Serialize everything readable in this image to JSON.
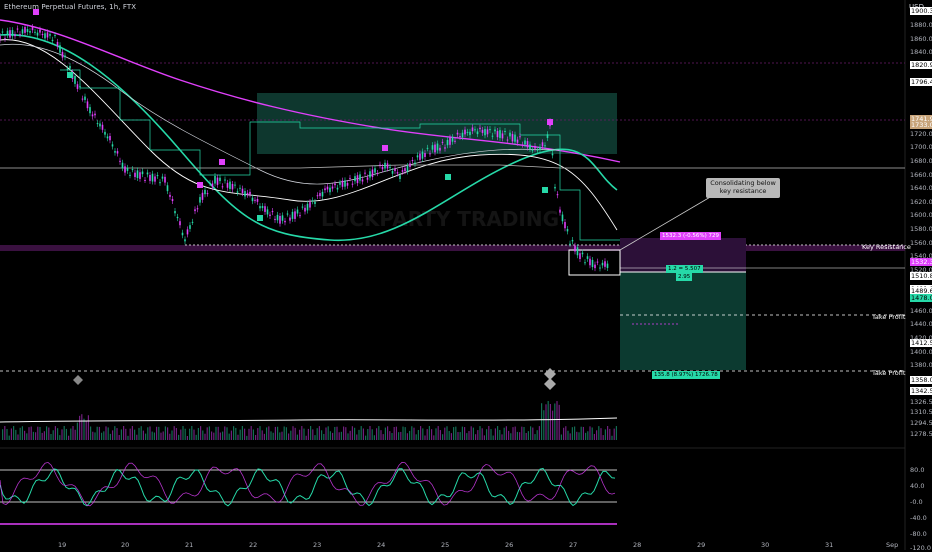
{
  "header": {
    "symbol": "Ethereum Perpetual Futures, 1h, FTX",
    "currency": "USD"
  },
  "price_axis": {
    "ticks": [
      "1900.3",
      "1880.0",
      "1860.0",
      "1840.0",
      "1820.9",
      "1796.4",
      "1741.9",
      "1733.0",
      "1720.0",
      "1700.0",
      "1680.0",
      "1660.0",
      "1640.0",
      "1620.0",
      "1600.0",
      "1580.0",
      "1560.0",
      "1540.0",
      "1532.3",
      "1510.8",
      "1520.0",
      "1491.8",
      "1489.6",
      "1478.0",
      "1460.0",
      "1440.0",
      "1412.5",
      "1420.0",
      "1400.0",
      "1380.0",
      "1358.0",
      "1342.5",
      "1326.5",
      "1310.5",
      "1294.5",
      "1278.5"
    ],
    "osc_ticks": [
      "80.0",
      "40.0",
      "-0.0",
      "-40.0",
      "-80.0",
      "-120.0"
    ],
    "tick_colors": {
      "1900.3": "#ffffff",
      "1820.9": "#ffffff",
      "1796.4": "#ffffff",
      "1741.9": "#c8a47a",
      "1733.0": "#c8a47a",
      "1532.3": "#e040fb",
      "1510.8": "#ffffff",
      "1491.8": "#ffffff",
      "1489.6": "#ffffff",
      "1478.0": "#26d9a8",
      "1412.5": "#ffffff",
      "1358.0": "#ffffff",
      "1342.5": "#ffffff"
    }
  },
  "date_axis": [
    "19",
    "20",
    "21",
    "22",
    "23",
    "24",
    "25",
    "26",
    "27",
    "28",
    "29",
    "30",
    "31",
    "Sep"
  ],
  "annotations": {
    "key_resistance": "Key Resistance",
    "take_profit_1": "Take Profit",
    "take_profit_2": "Take Profit",
    "callout": "Consolidating below key resistance",
    "risk_label": "1532.3 (-0.56%) 729",
    "position_label_1": "1.2 = 5.507",
    "position_label_2": "2.95",
    "target_label": "135.8 (8.97%) 1726.78"
  },
  "watermark": "LUCKPARTY TRADING",
  "colors": {
    "magenta": "#e040fb",
    "teal": "#26d9a8",
    "white": "#ffffff",
    "background": "#000000"
  },
  "chart_data": {
    "type": "line",
    "title": "Ethereum Perpetual Futures, 1h, FTX",
    "ylim": [
      1270,
      1905
    ],
    "key_resistance": 1510.8,
    "take_profits": [
      1412.5,
      1342.5
    ],
    "entry": 1491.8,
    "series": [
      {
        "x": [
          "19",
          "20",
          "21",
          "22",
          "23",
          "24",
          "25",
          "26",
          "27"
        ],
        "values": [
          1870,
          1660,
          1520,
          1620,
          1600,
          1660,
          1710,
          1690,
          1500
        ]
      }
    ]
  }
}
